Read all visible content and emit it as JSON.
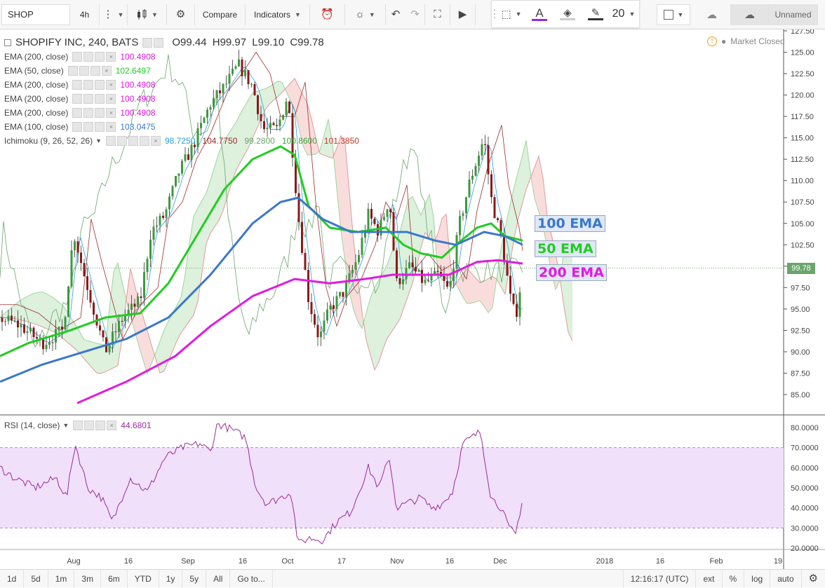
{
  "toolbar": {
    "symbol": "SHOP",
    "interval": "4h",
    "compare_label": "Compare",
    "indicators_label": "Indicators",
    "font_size": "20",
    "layout_name": "Unnamed"
  },
  "chart_title": {
    "name": "SHOPIFY INC, 240, BATS",
    "open": "O99.44",
    "high": "H99.97",
    "low": "L99.10",
    "close": "C99.78"
  },
  "market_status": "Market Closed",
  "legend": [
    {
      "label": "EMA (200, close)",
      "value": "100.4908",
      "color": "#d916d9"
    },
    {
      "label": "EMA (50, close)",
      "value": "102.6497",
      "color": "#22cc22"
    },
    {
      "label": "EMA (200, close)",
      "value": "100.4908",
      "color": "#d916d9"
    },
    {
      "label": "EMA (200, close)",
      "value": "100.4908",
      "color": "#d916d9"
    },
    {
      "label": "EMA (200, close)",
      "value": "100.4908",
      "color": "#d916d9"
    },
    {
      "label": "EMA (100, close)",
      "value": "103.0475",
      "color": "#3a78c9"
    }
  ],
  "ichimoku": {
    "label": "Ichimoku (9, 26, 52, 26)",
    "values": [
      {
        "v": "98.7250",
        "color": "#2a9fd6"
      },
      {
        "v": "104.7750",
        "color": "#9b2c2c"
      },
      {
        "v": "99.2800",
        "color": "#6aa56c"
      },
      {
        "v": "100.8600",
        "color": "#3aa83a"
      },
      {
        "v": "101.3850",
        "color": "#c0392b"
      }
    ]
  },
  "rsi": {
    "label": "RSI (14, close)",
    "value": "44.6801",
    "color": "#9b2c9b"
  },
  "annotations": [
    {
      "text": "100 EMA",
      "color": "#3a78c9"
    },
    {
      "text": "50 EMA",
      "color": "#22cc22"
    },
    {
      "text": "200 EMA",
      "color": "#e01be0"
    }
  ],
  "last_price": "99.78",
  "price_axis": [
    "127.50",
    "125.00",
    "122.50",
    "120.00",
    "117.50",
    "115.00",
    "112.50",
    "110.00",
    "107.50",
    "105.00",
    "102.50",
    "100.00",
    "97.50",
    "95.00",
    "92.50",
    "90.00",
    "87.50",
    "85.00"
  ],
  "rsi_axis": [
    "80.0000",
    "70.0000",
    "60.0000",
    "50.0000",
    "40.0000",
    "30.0000",
    "20.0000"
  ],
  "time_axis": [
    "Aug",
    "16",
    "Sep",
    "16",
    "Oct",
    "17",
    "Nov",
    "16",
    "Dec",
    "2018",
    "16",
    "Feb",
    "19"
  ],
  "range_buttons": [
    "1d",
    "5d",
    "1m",
    "3m",
    "6m",
    "YTD",
    "1y",
    "5y",
    "All"
  ],
  "goto_label": "Go to...",
  "clock": "12:16:17 (UTC)",
  "bottom_options": [
    "ext",
    "%",
    "log",
    "auto"
  ],
  "colors": {
    "ema50": "#22cc22",
    "ema100": "#3a78c9",
    "ema200": "#e01be0",
    "bull": "#3c9a3c",
    "bear": "#8b1a1a",
    "rsi_band": "#f0e0fa",
    "tenkan": "#2a9fd6",
    "kijun": "#9b2c2c",
    "chikou": "#6aa56c"
  }
}
